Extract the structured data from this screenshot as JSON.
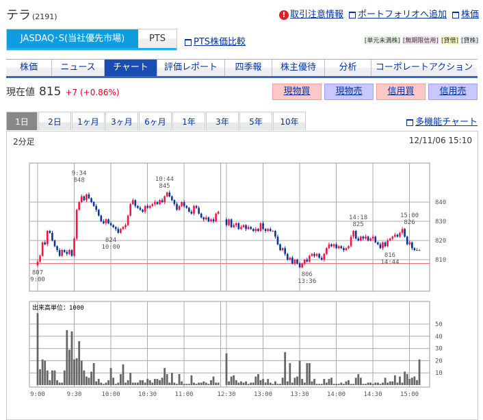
{
  "header": {
    "name": "テラ",
    "code": "(2191)",
    "links": [
      "取引注意情報",
      "ポートフォリオへ追加",
      "株価"
    ]
  },
  "market": {
    "active": "JASDAQ･S(当社優先市場)",
    "other": "PTS",
    "pts_compare": "PTS株価比較"
  },
  "badges": [
    {
      "label": "[単元未満株]",
      "color": "#e6f5e6"
    },
    {
      "label": "[無期限信用]",
      "color": "#f8e6f5"
    },
    {
      "label": "[貸借]",
      "color": "#faf5c8"
    },
    {
      "label": "[貸株]",
      "color": "#e6eef8"
    }
  ],
  "nav": [
    "株価",
    "ニュース",
    "チャート",
    "評価レポート",
    "四季報",
    "株主優待",
    "分析",
    "コーポレートアクション"
  ],
  "nav_active": 2,
  "quote": {
    "label": "現在値",
    "value": "815",
    "change": "+7 (+0.86%)"
  },
  "trade": [
    "現物買",
    "現物売",
    "信用買",
    "信用売"
  ],
  "periods": [
    "1日",
    "2日",
    "1ヶ月",
    "3ヶ月",
    "6ヶ月",
    "1年",
    "3年",
    "5年",
    "10年"
  ],
  "multi_chart": "多機能チャート",
  "chart": {
    "interval": "2分足",
    "timestamp": "12/11/06 15:10",
    "volume_unit": "出来高単位：1000",
    "price_ticks": [
      840,
      830,
      820,
      810
    ],
    "volume_ticks": [
      50,
      40,
      30,
      20,
      10
    ],
    "xlabels": [
      "9:00",
      "9:30",
      "10:00",
      "10:30",
      "11:00",
      "12:30",
      "13:00",
      "13:30",
      "14:00",
      "14:30",
      "15:00"
    ],
    "prev_close": 808,
    "annotations": [
      {
        "t": "9:34",
        "p": "848",
        "above": true
      },
      {
        "t": "10:00",
        "p": "824",
        "above": false
      },
      {
        "t": "10:44",
        "p": "845",
        "above": true
      },
      {
        "t": "9:00",
        "p": "807",
        "above": false
      },
      {
        "t": "13:36",
        "p": "806",
        "above": false
      },
      {
        "t": "14:18",
        "p": "825",
        "above": true
      },
      {
        "t": "14:44",
        "p": "816",
        "above": false
      },
      {
        "t": "15:00",
        "p": "826",
        "above": true
      }
    ],
    "colors": {
      "up": "#ff1040",
      "down": "#0a3399",
      "volume": "#666666"
    },
    "am_open": 807,
    "am_close": [
      809,
      812,
      819,
      818,
      825,
      824,
      820,
      817,
      815,
      812,
      815,
      814,
      813,
      815,
      812,
      821,
      836,
      840,
      843,
      841,
      844,
      842,
      840,
      838,
      836,
      833,
      830,
      829,
      831,
      829,
      828,
      827,
      826,
      824,
      826,
      827,
      828,
      833,
      839,
      841,
      838,
      837,
      836,
      835,
      838,
      837,
      838,
      839,
      840,
      839,
      841,
      840,
      843,
      845,
      843,
      841,
      839,
      836,
      838,
      840,
      838,
      837,
      835,
      834,
      838,
      837,
      834,
      832,
      831,
      832,
      830,
      831,
      830,
      834,
      835
    ],
    "pm_open": 831,
    "pm_close": [
      828,
      831,
      827,
      828,
      829,
      826,
      827,
      828,
      826,
      827,
      826,
      825,
      826,
      825,
      829,
      826,
      825,
      826,
      825,
      825,
      822,
      818,
      815,
      816,
      813,
      810,
      811,
      808,
      810,
      808,
      806,
      808,
      810,
      809,
      812,
      813,
      812,
      813,
      811,
      810,
      813,
      816,
      818,
      817,
      818,
      816,
      817,
      816,
      815,
      816,
      817,
      822,
      825,
      821,
      820,
      822,
      821,
      822,
      820,
      821,
      822,
      819,
      818,
      816,
      819,
      817,
      820,
      821,
      822,
      823,
      822,
      824,
      826,
      822,
      818,
      819,
      816,
      815,
      815,
      815
    ],
    "am_volume": [
      59,
      13,
      21,
      20,
      12,
      4,
      12,
      12,
      4,
      2,
      2,
      12,
      45,
      29,
      44,
      21,
      22,
      36,
      20,
      12,
      7,
      6,
      11,
      18,
      3,
      5,
      2,
      1,
      2,
      4,
      14,
      6,
      1,
      2,
      9,
      17,
      2,
      4,
      10,
      2,
      2,
      2,
      4,
      4,
      2,
      5,
      4,
      2,
      5,
      5,
      4,
      6,
      14,
      9,
      2,
      10,
      2,
      1,
      9,
      3,
      1,
      1,
      1,
      8,
      2,
      1,
      2,
      2,
      3,
      2,
      1,
      4,
      7,
      2,
      2
    ],
    "pm_volume": [
      26,
      3,
      7,
      8,
      4,
      2,
      3,
      2,
      3,
      1,
      2,
      2,
      7,
      9,
      4,
      5,
      2,
      5,
      2,
      1,
      3,
      1,
      1,
      6,
      27,
      3,
      18,
      2,
      6,
      7,
      20,
      5,
      2,
      18,
      18,
      3,
      5,
      1,
      1,
      1,
      5,
      2,
      5,
      6,
      1,
      1,
      1,
      2,
      1,
      3,
      4,
      1,
      1,
      6,
      9,
      6,
      1,
      1,
      2,
      2,
      1,
      2,
      2,
      1,
      2,
      6,
      2,
      3,
      3,
      8,
      2,
      7,
      2,
      11,
      9,
      5,
      6,
      7,
      4,
      21
    ]
  }
}
